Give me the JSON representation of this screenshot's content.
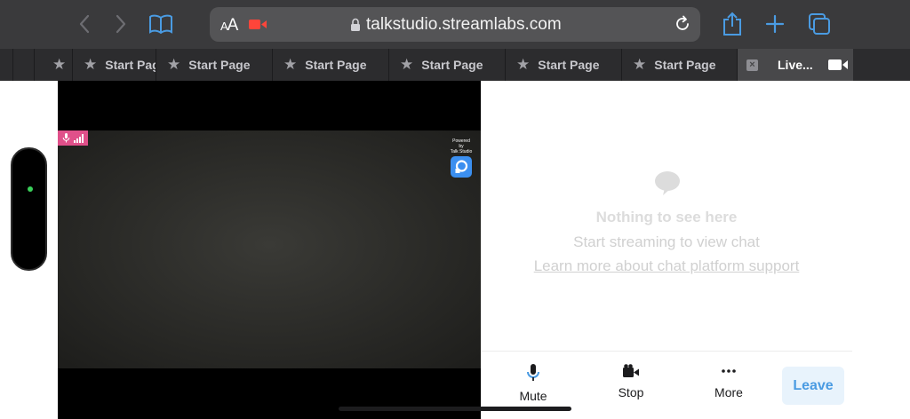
{
  "browser": {
    "text_size_label": {
      "small": "A",
      "large": "A"
    },
    "url": "talkstudio.streamlabs.com",
    "icons": [
      "back-icon",
      "forward-icon",
      "bookmarks-icon",
      "recording-camera-icon",
      "lock-icon",
      "reload-icon",
      "share-icon",
      "new-tab-icon",
      "tabs-overview-icon"
    ]
  },
  "tabs": [
    {
      "label": "Start Page",
      "icon": "star-icon"
    },
    {
      "label": "Start Page",
      "icon": "star-icon"
    },
    {
      "label": "Start Page",
      "icon": "star-icon"
    },
    {
      "label": "Start Page",
      "icon": "star-icon"
    },
    {
      "label": "Start Page",
      "icon": "star-icon"
    },
    {
      "label": "Start Page",
      "icon": "star-icon"
    },
    {
      "label": "Live...",
      "icon": "close-icon",
      "active": true
    }
  ],
  "video": {
    "powered_by": "Powered by",
    "brand": "Talk Studio"
  },
  "chat": {
    "empty_title": "Nothing to see here",
    "empty_subtitle": "Start streaming to view chat",
    "empty_link": "Learn more about chat platform support"
  },
  "controls": {
    "mute": "Mute",
    "stop": "Stop",
    "more": "More",
    "leave": "Leave"
  },
  "colors": {
    "accent_blue": "#4a9be2",
    "mic_badge": "#e0508a",
    "recording_red": "#ff453a",
    "status_green": "#3ad05a"
  }
}
